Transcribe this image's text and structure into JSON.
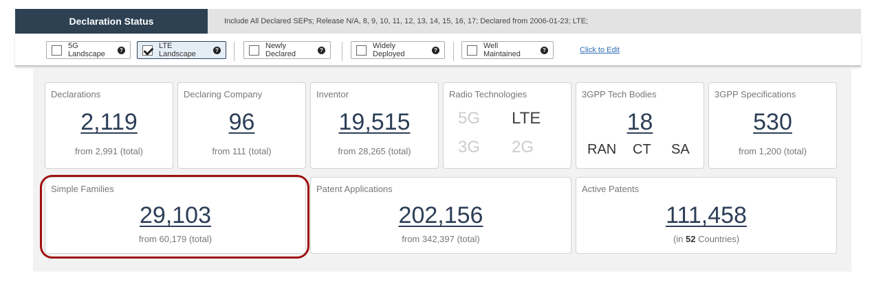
{
  "header": {
    "tab_label": "Declaration Status",
    "filter_summary": "Include All Declared SEPs; Release N/A, 8, 9, 10, 11, 12, 13, 14, 15, 16, 17; Declared from 2006-01-23; LTE;"
  },
  "filters": [
    {
      "label": "5G Landscape",
      "checked": false
    },
    {
      "label": "LTE Landscape",
      "checked": true
    },
    {
      "label": "Newly Declared",
      "checked": false
    },
    {
      "label": "Widely Deployed",
      "checked": false
    },
    {
      "label": "Well Maintained",
      "checked": false
    }
  ],
  "edit_link": "Click to Edit",
  "help_glyph": "?",
  "cards": {
    "declarations": {
      "title": "Declarations",
      "value": "2,119",
      "sub": "from 2,991 (total)"
    },
    "declaring_company": {
      "title": "Declaring Company",
      "value": "96",
      "sub": "from 111 (total)"
    },
    "inventor": {
      "title": "Inventor",
      "value": "19,515",
      "sub": "from 28,265 (total)"
    },
    "radio_technologies": {
      "title": "Radio Technologies",
      "items": [
        {
          "label": "5G",
          "active": false
        },
        {
          "label": "LTE",
          "active": true
        },
        {
          "label": "3G",
          "active": false
        },
        {
          "label": "2G",
          "active": false
        }
      ]
    },
    "tech_bodies": {
      "title": "3GPP Tech Bodies",
      "value": "18",
      "bodies": [
        "RAN",
        "CT",
        "SA"
      ]
    },
    "specifications": {
      "title": "3GPP Specifications",
      "value": "530",
      "sub": "from 1,200 (total)"
    },
    "simple_families": {
      "title": "Simple Families",
      "value": "29,103",
      "sub": "from 60,179 (total)"
    },
    "patent_applications": {
      "title": "Patent Applications",
      "value": "202,156",
      "sub": "from 342,397 (total)"
    },
    "active_patents": {
      "title": "Active Patents",
      "value": "111,458",
      "sub_prefix": "(in ",
      "sub_count": "52",
      "sub_suffix": " Countries)"
    }
  },
  "colors": {
    "header_dark": "#2e4153",
    "value_text": "#2c3e56",
    "highlight": "#a01010",
    "radio_inactive": "#cccccc",
    "radio_active": "#444444"
  }
}
